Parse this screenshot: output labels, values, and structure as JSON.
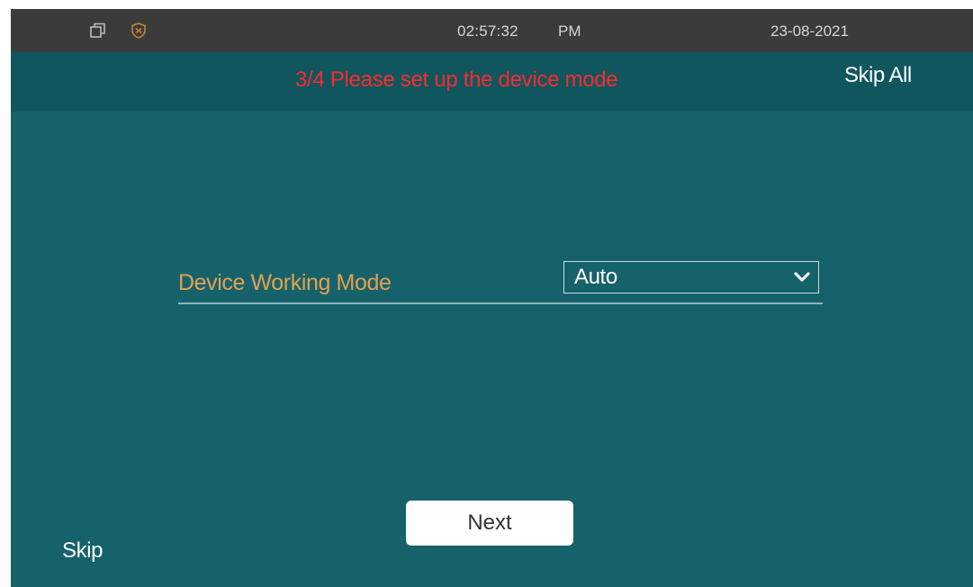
{
  "status_bar": {
    "icons": [
      "window-restore-icon",
      "shield-icon"
    ],
    "time": "02:57:32",
    "ampm": "PM",
    "date": "23-08-2021"
  },
  "header": {
    "title": "3/4 Please set up the device mode",
    "skip_all_label": "Skip All"
  },
  "form": {
    "device_working_mode_label": "Device Working Mode",
    "device_working_mode_value": "Auto"
  },
  "footer": {
    "next_label": "Next",
    "skip_label": "Skip"
  },
  "colors": {
    "background": "#16626b",
    "header": "#0f565f",
    "status_bar": "#3b3b3b",
    "title_red": "#ff2a2a",
    "label_orange": "#e3a04e"
  }
}
